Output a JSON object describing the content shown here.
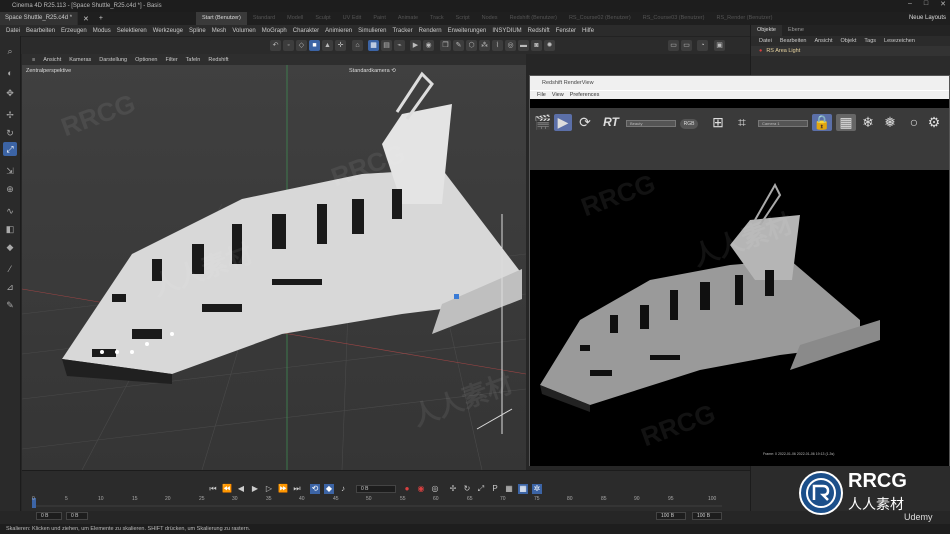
{
  "window": {
    "title": "Cinema 4D R25.113 - [Space Shuttle_R25.c4d *] - Basis",
    "controls": [
      "–",
      "□",
      "✕"
    ]
  },
  "tabs": [
    "Space Shuttle_R25.c4d *"
  ],
  "layouts": {
    "items": [
      "Start (Benutzer)",
      "Standard",
      "Modell",
      "Sculpt",
      "UV Edit",
      "Paint",
      "Animate",
      "Track",
      "Script",
      "Nodes",
      "Redshift (Benutzer)",
      "RS_Course02 (Benutzer)",
      "RS_Course03 (Benutzer)",
      "RS_Render (Benutzer)"
    ],
    "active": "Start (Benutzer)",
    "new_layouts": "Neue Layouts"
  },
  "menu": [
    "Datei",
    "Bearbeiten",
    "Erzeugen",
    "Modus",
    "Selektieren",
    "Werkzeuge",
    "Spline",
    "Mesh",
    "Volumen",
    "MoGraph",
    "Charakter",
    "Animieren",
    "Simulieren",
    "Tracker",
    "Rendern",
    "Erweiterungen",
    "INSYDIUM",
    "Redshift",
    "Fenster",
    "Hilfe"
  ],
  "viewport": {
    "menu": [
      "Ansicht",
      "Kameras",
      "Darstellung",
      "Optionen",
      "Filter",
      "Tafeln",
      "Redshift"
    ],
    "label_left": "Zentralperspektive",
    "label_center": "Standardkamera ⟲"
  },
  "right_panel": {
    "tabs": [
      "Objekte",
      "Ebene"
    ],
    "active_tab": "Objekte",
    "menu": [
      "Datei",
      "Bearbeiten",
      "Ansicht",
      "Objekt",
      "Tags",
      "Lesezeichen"
    ],
    "object": "RS Area Light"
  },
  "render_view": {
    "title": "Redshift RenderView",
    "menu": [
      "File",
      "View",
      "Preferences"
    ],
    "rt_label": "RT",
    "select1": "Beauty",
    "rgb_label": "RGB",
    "select2": "Camera 1",
    "footer": "Frame: 0   2022-01-06  2022-01-06  19:13 (1.3s)"
  },
  "timeline": {
    "current_frame": "0 B",
    "ruler": [
      "0",
      "5",
      "10",
      "15",
      "20",
      "25",
      "30",
      "35",
      "40",
      "45",
      "50",
      "55",
      "60",
      "65",
      "70",
      "75",
      "80",
      "85",
      "90",
      "95",
      "100"
    ],
    "start": "0 B",
    "start2": "0 B",
    "end": "100 B",
    "end2": "100 B"
  },
  "status": "Skalieren: Klicken und ziehen, um Elemente zu skalieren. SHIFT drücken, um Skalierung zu rastern.",
  "watermark": {
    "brand": "RRCG",
    "sub": "人人素材",
    "udemy": "Udemy"
  },
  "colors": {
    "accent": "#3c64a5",
    "record": "#d94040"
  }
}
